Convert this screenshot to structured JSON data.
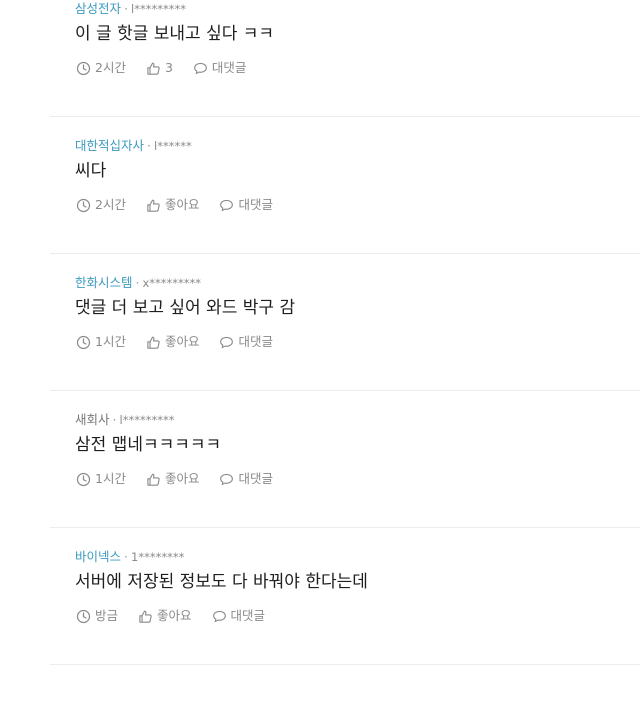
{
  "comments": [
    {
      "company": "삼성전자",
      "user": "l*********",
      "text": "이 글 핫글 보내고 싶다 ㅋㅋ",
      "time": "2시간",
      "like": "3",
      "reply": "대댓글"
    },
    {
      "company": "대한적십자사",
      "user": "l******",
      "text": "씨다",
      "time": "2시간",
      "like": "좋아요",
      "reply": "대댓글"
    },
    {
      "company": "한화시스템",
      "user": "x*********",
      "text": "댓글 더 보고 싶어 와드 박구 감",
      "time": "1시간",
      "like": "좋아요",
      "reply": "대댓글"
    },
    {
      "company": "새회사",
      "user": "l*********",
      "text": "삼전 맵네ㅋㅋㅋㅋㅋ",
      "time": "1시간",
      "like": "좋아요",
      "reply": "대댓글"
    },
    {
      "company": "바이넥스",
      "user": "1********",
      "text": "서버에 저장된 정보도 다 바꿔야 한다는데",
      "time": "방금",
      "like": "좋아요",
      "reply": "대댓글"
    }
  ],
  "separator": "·",
  "colors": {
    "company_link": "#3d9bc1",
    "company_plain": "#777777",
    "meta_gray": "#8a8a8a",
    "divider": "#ececec"
  },
  "icons": {
    "time": "clock-icon",
    "like": "thumbs-up-icon",
    "reply": "speech-bubble-icon"
  }
}
